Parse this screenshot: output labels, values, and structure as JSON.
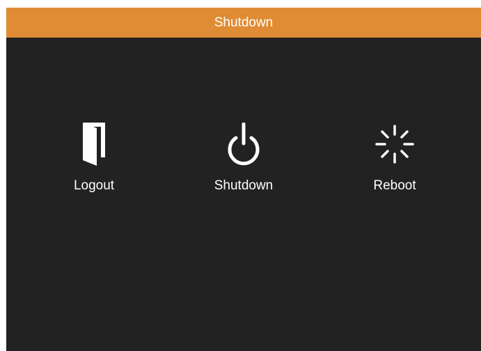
{
  "dialog": {
    "title": "Shutdown",
    "accent_color": "#e08c35",
    "background_color": "#222222"
  },
  "actions": [
    {
      "label": "Logout",
      "icon": "door-exit-icon"
    },
    {
      "label": "Shutdown",
      "icon": "power-icon"
    },
    {
      "label": "Reboot",
      "icon": "loading-spinner-icon"
    }
  ]
}
